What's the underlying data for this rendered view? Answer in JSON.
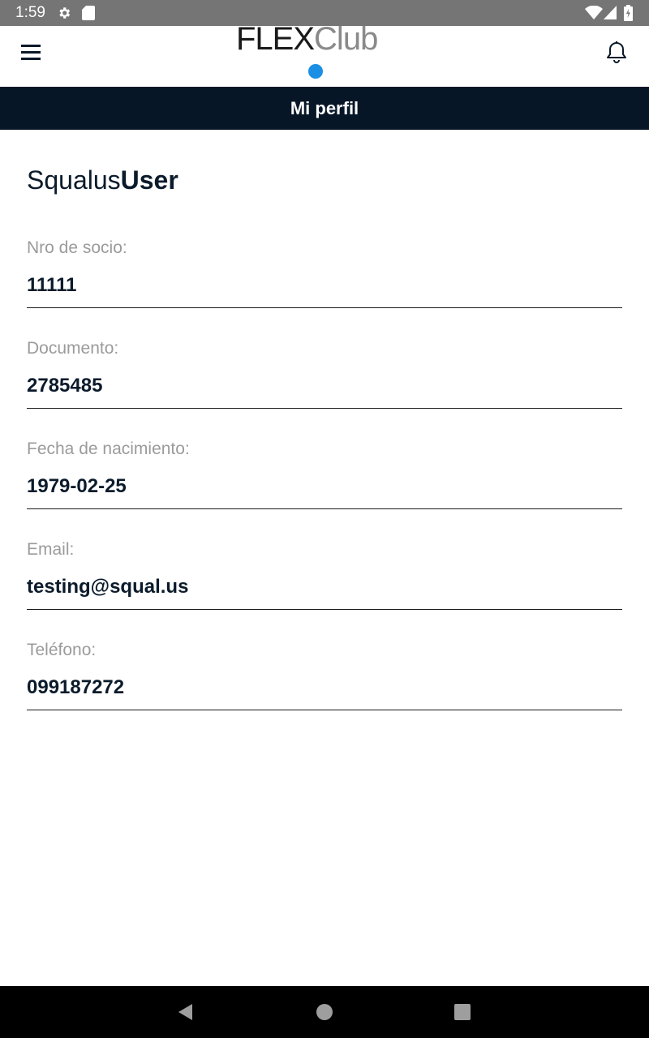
{
  "status_bar": {
    "time": "1:59",
    "icons": [
      "gear-icon",
      "sd-card-icon",
      "wifi-icon",
      "signal-icon",
      "battery-icon"
    ]
  },
  "header": {
    "logo_strong": "FLEX",
    "logo_light": "Club",
    "icons": [
      "menu-icon",
      "bell-icon"
    ],
    "accent_color": "#1a8fe3"
  },
  "page": {
    "title": "Mi perfil",
    "title_bar_color": "#061627"
  },
  "profile": {
    "first_name": "Squalus",
    "last_name": "User",
    "fields": [
      {
        "label": "Nro de socio:",
        "value": "11111"
      },
      {
        "label": "Documento:",
        "value": "2785485"
      },
      {
        "label": "Fecha de nacimiento:",
        "value": "1979-02-25"
      },
      {
        "label": "Email:",
        "value": "testing@squal.us"
      },
      {
        "label": "Teléfono:",
        "value": "099187272"
      }
    ]
  },
  "nav_bar": {
    "icons": [
      "back-icon",
      "home-icon",
      "recents-icon"
    ]
  }
}
